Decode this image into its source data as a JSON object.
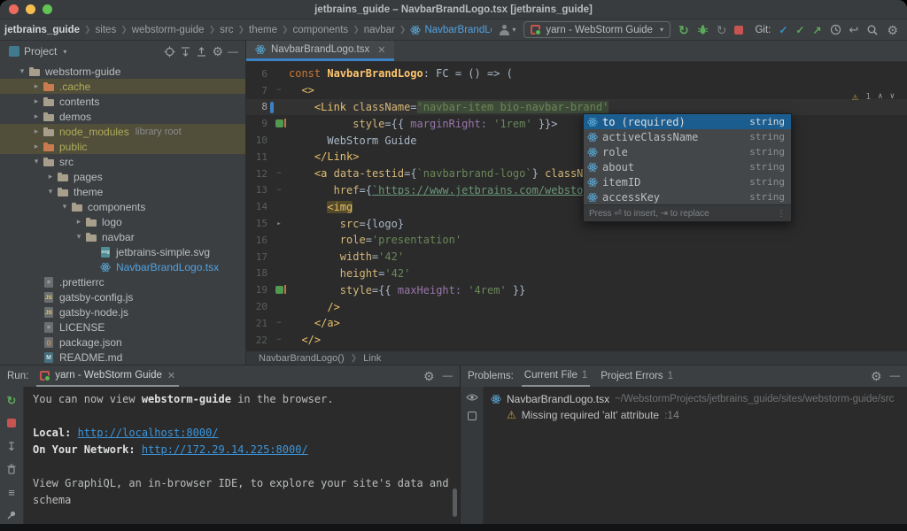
{
  "window": {
    "title": "jetbrains_guide – NavbarBrandLogo.tsx [jetbrains_guide]"
  },
  "colors": {
    "accent_blue": "#3B82C4",
    "warning_yellow": "#C9A23E",
    "error_red": "#C75450",
    "success_green": "#5BA75B",
    "link_blue": "#3B96DD",
    "excluded_yellow": "#AFAC5C"
  },
  "toolbar": {
    "breadcrumbs": [
      "jetbrains_guide",
      "sites",
      "webstorm-guide",
      "src",
      "theme",
      "components",
      "navbar"
    ],
    "active_file": "NavbarBrandLogo.tsx",
    "run_config": "yarn - WebStorm Guide",
    "git_label": "Git:"
  },
  "project": {
    "title": "Project",
    "tree": [
      {
        "label": "webstorm-guide",
        "depth": 1,
        "chevron": "v",
        "icon": "folder"
      },
      {
        "label": ".cache",
        "depth": 2,
        "chevron": ">",
        "icon": "folder-excluded",
        "row": "sel",
        "text": "excluded"
      },
      {
        "label": "contents",
        "depth": 2,
        "chevron": ">",
        "icon": "folder"
      },
      {
        "label": "demos",
        "depth": 2,
        "chevron": ">",
        "icon": "folder"
      },
      {
        "label": "node_modules",
        "depth": 2,
        "chevron": ">",
        "icon": "folder",
        "row": "sel",
        "text": "excluded",
        "suffix": "library root"
      },
      {
        "label": "public",
        "depth": 2,
        "chevron": ">",
        "icon": "folder-excluded",
        "row": "sel",
        "text": "excluded"
      },
      {
        "label": "src",
        "depth": 2,
        "chevron": "v",
        "icon": "folder"
      },
      {
        "label": "pages",
        "depth": 3,
        "chevron": ">",
        "icon": "folder"
      },
      {
        "label": "theme",
        "depth": 3,
        "chevron": "v",
        "icon": "folder"
      },
      {
        "label": "components",
        "depth": 4,
        "chevron": "v",
        "icon": "folder"
      },
      {
        "label": "logo",
        "depth": 5,
        "chevron": ">",
        "icon": "folder"
      },
      {
        "label": "navbar",
        "depth": 5,
        "chevron": "v",
        "icon": "folder"
      },
      {
        "label": "jetbrains-simple.svg",
        "depth": 6,
        "icon": "svg-file"
      },
      {
        "label": "NavbarBrandLogo.tsx",
        "depth": 6,
        "icon": "react",
        "text": "open"
      },
      {
        "label": ".prettierrc",
        "depth": 2,
        "icon": "config"
      },
      {
        "label": "gatsby-config.js",
        "depth": 2,
        "icon": "js"
      },
      {
        "label": "gatsby-node.js",
        "depth": 2,
        "icon": "js"
      },
      {
        "label": "LICENSE",
        "depth": 2,
        "icon": "text"
      },
      {
        "label": "package.json",
        "depth": 2,
        "icon": "json"
      },
      {
        "label": "README.md",
        "depth": 2,
        "icon": "md"
      }
    ]
  },
  "editor": {
    "tab": "NavbarBrandLogo.tsx",
    "breadcrumb": [
      "NavbarBrandLogo()",
      "Link"
    ],
    "inspection_count": "1",
    "lines": [
      {
        "n": 6,
        "tokens": [
          {
            "t": "const ",
            "c": "kw"
          },
          {
            "t": "NavbarBrandLogo",
            "c": "fn"
          },
          {
            "t": ": FC = () => (",
            "c": "pl"
          }
        ]
      },
      {
        "n": 7,
        "fold": true,
        "tokens": [
          {
            "t": "  "
          },
          {
            "t": "<>",
            "c": "tag"
          }
        ]
      },
      {
        "n": 8,
        "cur": true,
        "tokens": [
          {
            "t": "    "
          },
          {
            "t": "<Link",
            "c": "tag"
          },
          {
            "t": " "
          },
          {
            "t": "className",
            "c": "attr"
          },
          {
            "t": "=",
            "c": "pl"
          },
          {
            "t": "'navbar-item bio-navbar-brand'",
            "c": "str selbg"
          }
        ]
      },
      {
        "n": 9,
        "gutter": "green",
        "tokens": [
          {
            "t": "          "
          },
          {
            "t": "style",
            "c": "attr"
          },
          {
            "t": "=",
            "c": "pl"
          },
          {
            "t": "{{ ",
            "c": "pl"
          },
          {
            "t": "marginRight:",
            "c": "prop"
          },
          {
            "t": " "
          },
          {
            "t": "'1rem'",
            "c": "str"
          },
          {
            "t": " }}>",
            "c": "pl"
          }
        ]
      },
      {
        "n": 10,
        "tokens": [
          {
            "t": "      WebStorm Guide",
            "c": "pl"
          }
        ]
      },
      {
        "n": 11,
        "tokens": [
          {
            "t": "    "
          },
          {
            "t": "</Link>",
            "c": "tag"
          }
        ]
      },
      {
        "n": 12,
        "fold": true,
        "tokens": [
          {
            "t": "    "
          },
          {
            "t": "<a",
            "c": "tag"
          },
          {
            "t": " "
          },
          {
            "t": "data-testid",
            "c": "attr"
          },
          {
            "t": "=",
            "c": "pl"
          },
          {
            "t": "{",
            "c": "pl"
          },
          {
            "t": "`navbarbrand-logo`",
            "c": "str"
          },
          {
            "t": "}",
            "c": "pl"
          },
          {
            "t": " "
          },
          {
            "t": "className",
            "c": "attr"
          },
          {
            "t": "=",
            "c": "pl"
          }
        ]
      },
      {
        "n": 13,
        "fold": true,
        "tokens": [
          {
            "t": "       "
          },
          {
            "t": "href",
            "c": "attr"
          },
          {
            "t": "=",
            "c": "pl"
          },
          {
            "t": "{",
            "c": "pl"
          },
          {
            "t": "`https://www.jetbrains.com/webstorm/`",
            "c": "str link"
          },
          {
            "t": "}",
            "c": "pl"
          }
        ]
      },
      {
        "n": 14,
        "tokens": [
          {
            "t": "      "
          },
          {
            "t": "<img",
            "c": "tag warnbg"
          }
        ]
      },
      {
        "n": 15,
        "gutter": "arrow",
        "tokens": [
          {
            "t": "        "
          },
          {
            "t": "src",
            "c": "attr"
          },
          {
            "t": "=",
            "c": "pl"
          },
          {
            "t": "{logo}",
            "c": "pl"
          }
        ]
      },
      {
        "n": 16,
        "tokens": [
          {
            "t": "        "
          },
          {
            "t": "role",
            "c": "attr"
          },
          {
            "t": "=",
            "c": "pl"
          },
          {
            "t": "'presentation'",
            "c": "str"
          }
        ]
      },
      {
        "n": 17,
        "tokens": [
          {
            "t": "        "
          },
          {
            "t": "width",
            "c": "attr"
          },
          {
            "t": "=",
            "c": "pl"
          },
          {
            "t": "'42'",
            "c": "str"
          }
        ]
      },
      {
        "n": 18,
        "tokens": [
          {
            "t": "        "
          },
          {
            "t": "height",
            "c": "attr"
          },
          {
            "t": "=",
            "c": "pl"
          },
          {
            "t": "'42'",
            "c": "str"
          }
        ]
      },
      {
        "n": 19,
        "gutter": "green",
        "tokens": [
          {
            "t": "        "
          },
          {
            "t": "style",
            "c": "attr"
          },
          {
            "t": "=",
            "c": "pl"
          },
          {
            "t": "{{ ",
            "c": "pl"
          },
          {
            "t": "maxHeight:",
            "c": "prop"
          },
          {
            "t": " "
          },
          {
            "t": "'4rem'",
            "c": "str"
          },
          {
            "t": " }}",
            "c": "pl"
          }
        ]
      },
      {
        "n": 20,
        "tokens": [
          {
            "t": "      "
          },
          {
            "t": "/>",
            "c": "tag"
          }
        ]
      },
      {
        "n": 21,
        "fold": true,
        "tokens": [
          {
            "t": "    "
          },
          {
            "t": "</a>",
            "c": "tag"
          }
        ]
      },
      {
        "n": 22,
        "fold": true,
        "tokens": [
          {
            "t": "  "
          },
          {
            "t": "</>",
            "c": "tag"
          }
        ]
      }
    ]
  },
  "popup": {
    "items": [
      {
        "label": "to",
        "suffix": "(required)",
        "type": "string",
        "selected": true
      },
      {
        "label": "activeClassName",
        "type": "string"
      },
      {
        "label": "role",
        "type": "string"
      },
      {
        "label": "about",
        "type": "string"
      },
      {
        "label": "itemID",
        "type": "string"
      },
      {
        "label": "accessKey",
        "type": "string"
      }
    ],
    "hint": "Press ⏎ to insert, ⇥ to replace"
  },
  "run": {
    "label": "Run:",
    "tab": "yarn - WebStorm Guide",
    "console": [
      [
        {
          "t": "You can now view "
        },
        {
          "t": "webstorm-guide",
          "c": "b"
        },
        {
          "t": " in the browser."
        }
      ],
      [],
      [
        {
          "t": "  Local:            ",
          "c": "b"
        },
        {
          "t": "http://localhost:8000/",
          "c": "link"
        }
      ],
      [
        {
          "t": "  On Your Network:  ",
          "c": "b"
        },
        {
          "t": "http://172.29.14.225:8000/",
          "c": "link"
        }
      ],
      [],
      [
        {
          "t": "View GraphiQL, an in-browser IDE, to explore your site's data and"
        }
      ],
      [
        {
          "t": "schema"
        }
      ]
    ]
  },
  "problems": {
    "label": "Problems:",
    "tabs": [
      {
        "label": "Current File",
        "count": "1",
        "active": true
      },
      {
        "label": "Project Errors",
        "count": "1"
      }
    ],
    "file": "NavbarBrandLogo.tsx",
    "path": "~/WebstormProjects/jetbrains_guide/sites/webstorm-guide/src",
    "warning": "Missing required 'alt' attribute",
    "line_ref": ":14"
  }
}
